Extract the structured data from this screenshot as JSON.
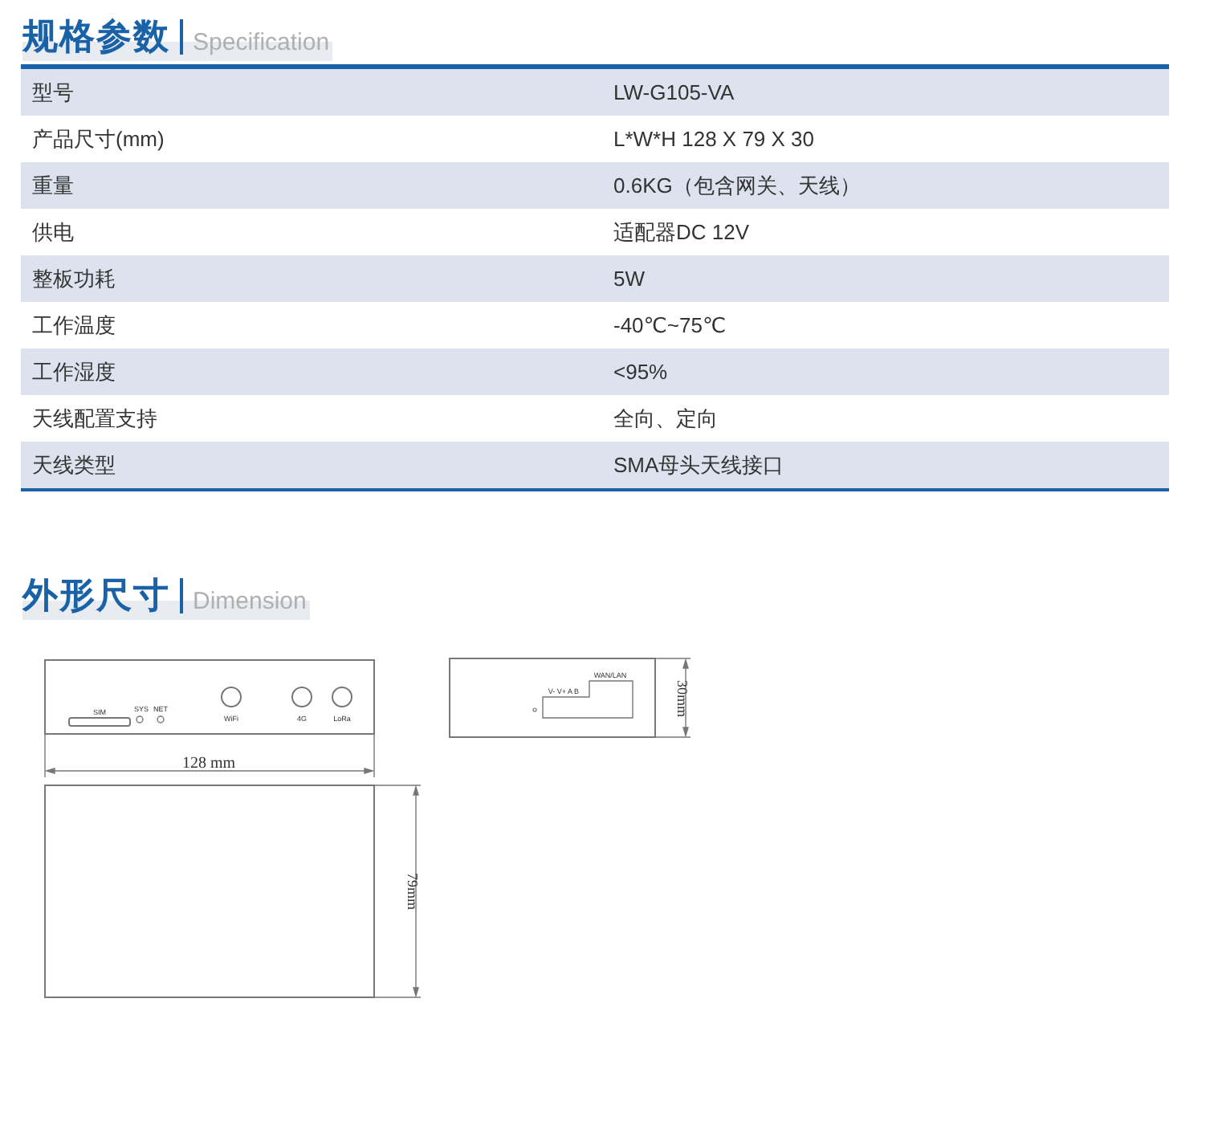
{
  "spec_section": {
    "title": "规格参数",
    "subtitle": "Specification",
    "rows": [
      {
        "label": "型号",
        "value": "LW-G105-VA"
      },
      {
        "label": "产品尺寸(mm)",
        "value": "L*W*H 128 X 79 X 30"
      },
      {
        "label": "重量",
        "value": "0.6KG（包含网关、天线）"
      },
      {
        "label": "供电",
        "value": "适配器DC 12V"
      },
      {
        "label": "整板功耗",
        "value": "5W"
      },
      {
        "label": "工作温度",
        "value": "-40℃~75℃"
      },
      {
        "label": "工作湿度",
        "value": "<95%"
      },
      {
        "label": "天线配置支持",
        "value": "全向、定向"
      },
      {
        "label": "天线类型",
        "value": "SMA母头天线接口"
      }
    ]
  },
  "dimension_section": {
    "title": "外形尺寸",
    "subtitle": "Dimension",
    "drawing": {
      "front_labels": [
        "SIM",
        "SYS",
        "NET",
        "WiFi",
        "4G",
        "LoRa"
      ],
      "width_label": "128 mm",
      "side_labels": [
        "V- V+ A B",
        "WAN/LAN"
      ],
      "height_label": "30mm",
      "depth_label": "79mm"
    }
  }
}
